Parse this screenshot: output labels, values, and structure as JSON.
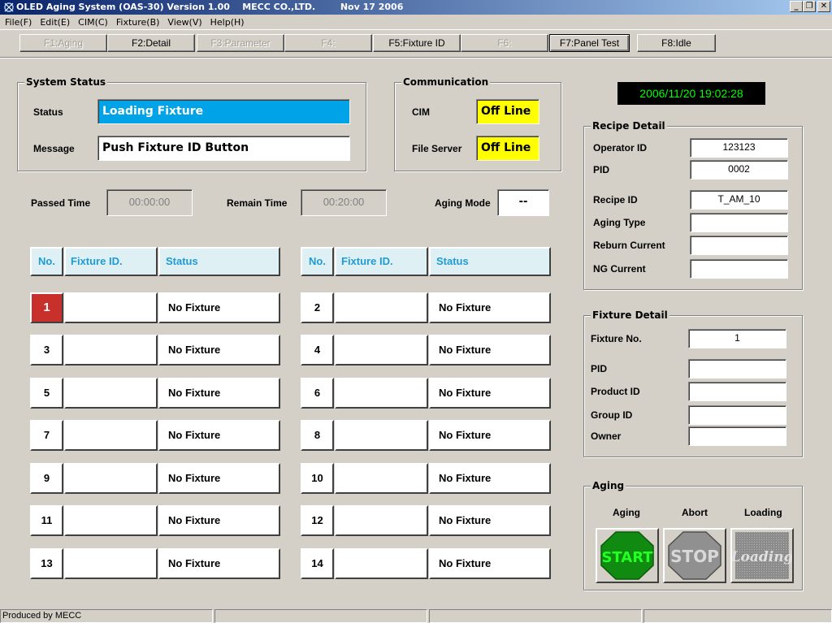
{
  "window": {
    "title": "OLED Aging System (OAS-30) Version 1.00    MECC CO.,LTD.        Nov 17 2006",
    "minimize": "_",
    "restore": "❐",
    "close": "✕"
  },
  "menu": [
    "File(F)",
    "Edit(E)",
    "CIM(C)",
    "Fixture(B)",
    "View(V)",
    "Help(H)"
  ],
  "fkeys": [
    {
      "label": "F1:Aging",
      "enabled": false
    },
    {
      "label": "F2:Detail",
      "enabled": true
    },
    {
      "label": "F3:Parameter",
      "enabled": false
    },
    {
      "label": "F4:",
      "enabled": false
    },
    {
      "label": "F5:Fixture ID",
      "enabled": true
    },
    {
      "label": "F6:",
      "enabled": false
    },
    {
      "label": "F7:Panel Test",
      "enabled": true,
      "active": true
    },
    {
      "label": "F8:Idle",
      "enabled": true
    }
  ],
  "system_status": {
    "title": "System Status",
    "status_label": "Status",
    "status_value": "Loading Fixture",
    "message_label": "Message",
    "message_value": "Push Fixture ID Button"
  },
  "communication": {
    "title": "Communication",
    "cim_label": "CIM",
    "cim_value": "Off Line",
    "fs_label": "File Server",
    "fs_value": "Off Line"
  },
  "clock": "2006/11/20 19:02:28",
  "timers": {
    "passed_label": "Passed Time",
    "passed_value": "00:00:00",
    "remain_label": "Remain Time",
    "remain_value": "00:20:00",
    "mode_label": "Aging Mode",
    "mode_value": "--"
  },
  "table": {
    "headers": [
      "No.",
      "Fixture ID.",
      "Status"
    ],
    "rows": [
      {
        "no": "1",
        "id": "",
        "status": "No Fixture"
      },
      {
        "no": "2",
        "id": "",
        "status": "No Fixture"
      },
      {
        "no": "3",
        "id": "",
        "status": "No Fixture"
      },
      {
        "no": "4",
        "id": "",
        "status": "No Fixture"
      },
      {
        "no": "5",
        "id": "",
        "status": "No Fixture"
      },
      {
        "no": "6",
        "id": "",
        "status": "No Fixture"
      },
      {
        "no": "7",
        "id": "",
        "status": "No Fixture"
      },
      {
        "no": "8",
        "id": "",
        "status": "No Fixture"
      },
      {
        "no": "9",
        "id": "",
        "status": "No Fixture"
      },
      {
        "no": "10",
        "id": "",
        "status": "No Fixture"
      },
      {
        "no": "11",
        "id": "",
        "status": "No Fixture"
      },
      {
        "no": "12",
        "id": "",
        "status": "No Fixture"
      },
      {
        "no": "13",
        "id": "",
        "status": "No Fixture"
      },
      {
        "no": "14",
        "id": "",
        "status": "No Fixture"
      }
    ]
  },
  "recipe": {
    "title": "Recipe Detail",
    "operator_label": "Operator ID",
    "operator_value": "123123",
    "pid_label": "PID",
    "pid_value": "0002",
    "recipe_label": "Recipe ID",
    "recipe_value": "T_AM_10",
    "aging_type_label": "Aging Type",
    "aging_type_value": "",
    "reburn_label": "Reburn Current",
    "reburn_value": "",
    "ng_label": "NG Current",
    "ng_value": ""
  },
  "fixture": {
    "title": "Fixture Detail",
    "no_label": "Fixture No.",
    "no_value": "1",
    "pid_label": "PID",
    "pid_value": "",
    "product_label": "Product ID",
    "product_value": "",
    "group_label": "Group ID",
    "group_value": "",
    "owner_label": "Owner",
    "owner_value": ""
  },
  "aging": {
    "title": "Aging",
    "start_label": "Aging",
    "start_text": "START",
    "abort_label": "Abort",
    "stop_text": "STOP",
    "loading_label": "Loading",
    "loading_text": "Loading"
  },
  "statusbar": [
    "Produced by MECC",
    "",
    "",
    ""
  ],
  "colors": {
    "title_bar": "#0a246a",
    "status_blue": "#00a2e8",
    "offline_yellow": "#ffff00",
    "clock_green": "#00ff00",
    "header_text": "#1e9bd2",
    "selected_red": "#c8302c",
    "start_green": "#118a11",
    "stop_gray": "#909090"
  }
}
